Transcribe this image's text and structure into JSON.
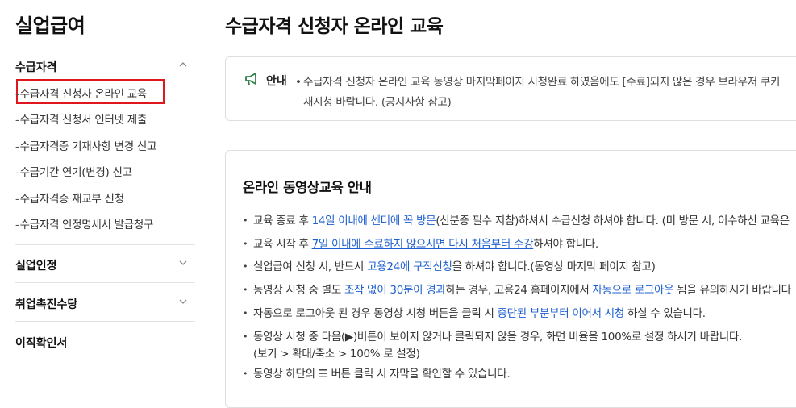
{
  "sidebar": {
    "title": "실업급여",
    "sections": [
      {
        "label": "수급자격",
        "expanded": true,
        "items": [
          "수급자격 신청자 온라인 교육",
          "수급자격 신청서 인터넷 제출",
          "수급자격증 기재사항 변경 신고",
          "수급기간 연기(변경) 신고",
          "수급자격증 재교부 신청",
          "수급자격 인정명세서 발급청구"
        ]
      },
      {
        "label": "실업인정",
        "expanded": false
      },
      {
        "label": "취업촉진수당",
        "expanded": false
      },
      {
        "label": "이직확인서",
        "expanded": false
      }
    ],
    "item_prefix": "-",
    "active_item": "수급자격 신청자 온라인 교육"
  },
  "main": {
    "title": "수급자격 신청자 온라인 교육",
    "notice": {
      "label": "안내",
      "icon": "megaphone-icon",
      "line1": "수급자격 신청자 온라인 교육 동영상 마지막페이지 시청완료 하였음에도 [수료]되지 않은 경우 브라우저 쿠키",
      "line2": "재시청 바랍니다. (공지사항 참고)"
    },
    "section_title": "온라인 동영상교육 안내",
    "items": {
      "i1": {
        "a": "교육 종료 후 ",
        "b": "14일 이내에 센터에 꼭 방문",
        "c": "(신분증 필수 지참)하셔서 수급신청 하셔야 합니다. (미 방문 시, 이수하신 교육은"
      },
      "i2": {
        "a": "교육 시작 후 ",
        "b": "7일 이내에 수료하지 않으시면 다시 처음부터 수강",
        "c": "하셔야 합니다."
      },
      "i3": {
        "a": "실업급여 신청 시, 반드시 ",
        "b": "고용24에 구직신청",
        "c": "을 하셔야 합니다.(동영상 마지막 페이지 참고)"
      },
      "i4": {
        "a": "동영상 시청 중 별도 ",
        "b": "조작 없이 30분이 경과",
        "c": "하는 경우, 고용24 홈페이지에서 ",
        "d": "자동으로 로그아웃",
        "e": " 됨을 유의하시기 바랍니다"
      },
      "i5": {
        "a": "자동으로 로그아웃 된 경우 동영상 시청 버튼을 클릭 시 ",
        "b": "중단된 부분부터 이어서 시청",
        "c": " 하실 수 있습니다."
      },
      "i6": {
        "a": "동영상 시청 중 다음(▶)버튼이 보이지 않거나 클릭되지 않을 경우, 화면 비율을 100%로 설정 하시기 바랍니다.",
        "b": "(보기 > 확대/축소 > 100% 로 설정)"
      },
      "i7": {
        "a": "동영상 하단의 ☰ 버튼 클릭 시 자막을 확인할 수 있습니다."
      }
    }
  },
  "colors": {
    "accent_link": "#1e5fcf",
    "active_border": "#e0161e",
    "notice_icon": "#2e7d4a"
  }
}
